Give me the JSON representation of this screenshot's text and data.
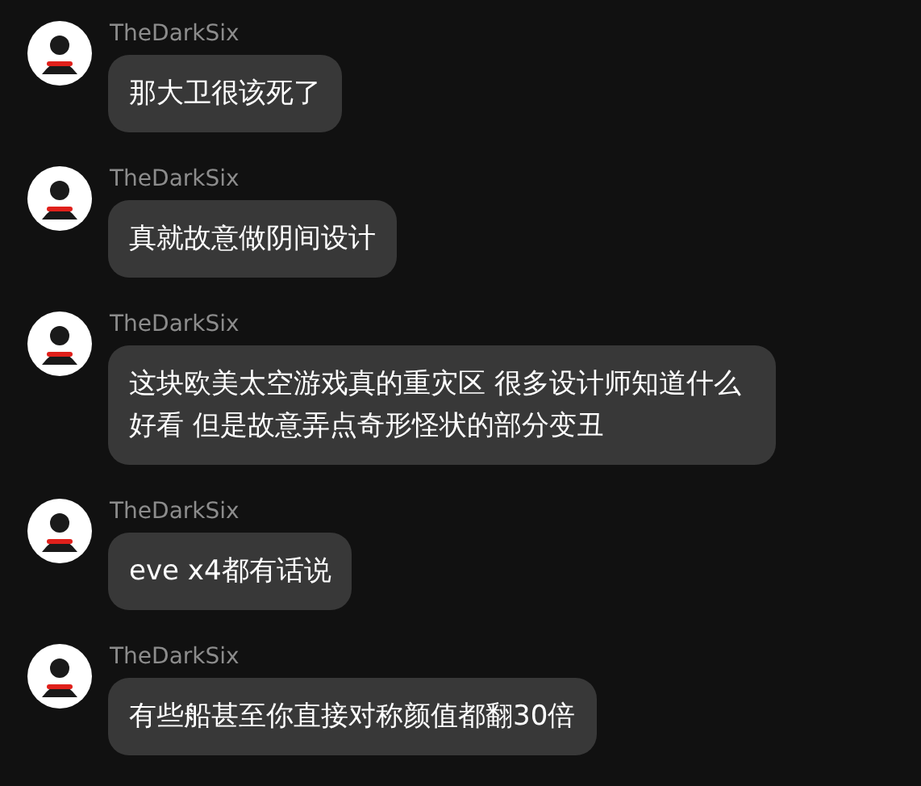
{
  "messages": [
    {
      "sender": "TheDarkSix",
      "text": "那大卫很该死了"
    },
    {
      "sender": "TheDarkSix",
      "text": "真就故意做阴间设计"
    },
    {
      "sender": "TheDarkSix",
      "text": "这块欧美太空游戏真的重灾区 很多设计师知道什么好看 但是故意弄点奇形怪状的部分变丑"
    },
    {
      "sender": "TheDarkSix",
      "text": "eve x4都有话说"
    },
    {
      "sender": "TheDarkSix",
      "text": "有些船甚至你直接对称颜值都翻30倍"
    }
  ]
}
